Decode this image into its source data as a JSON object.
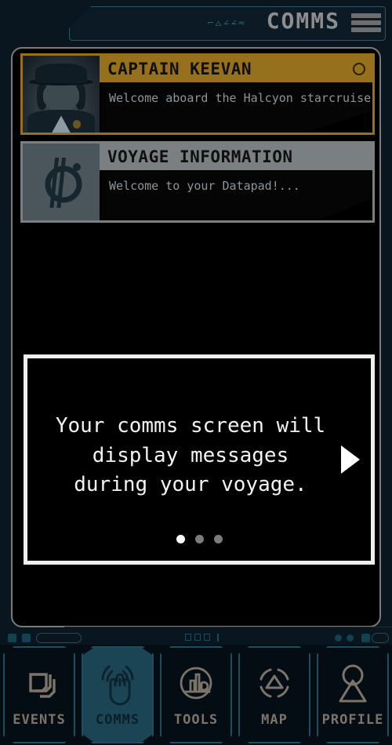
{
  "app": {
    "background_color": "#091620",
    "panel_color": "#000000"
  },
  "header": {
    "title": "COMMS",
    "aurebesh": "⌐△∠∠≈",
    "menu_icon": "hamburger-menu-icon",
    "accent_color": "#2b5560"
  },
  "messages": [
    {
      "sender": "CAPTAIN KEEVAN",
      "preview": "Welcome aboard the Halcyon starcruiser...",
      "unread": true,
      "accent_color": "#96701c",
      "avatar_icon": "captain-portrait"
    },
    {
      "sender": "VOYAGE INFORMATION",
      "preview": "Welcome to your Datapad!...",
      "unread": false,
      "accent_color": "#7a7f82",
      "avatar_icon": "halcyon-logo-icon"
    }
  ],
  "tooltip": {
    "text": "Your comms screen will display messages during your voyage.",
    "next_icon": "next-arrow-icon",
    "total_pages": 3,
    "current_page": 1
  },
  "bottom_nav": {
    "active": "COMMS",
    "items": [
      {
        "label": "EVENTS",
        "icon": "stacked-cards-icon",
        "active": false
      },
      {
        "label": "COMMS",
        "icon": "signal-hand-icon",
        "active": true
      },
      {
        "label": "TOOLS",
        "icon": "city-search-icon",
        "active": false
      },
      {
        "label": "MAP",
        "icon": "map-compass-icon",
        "active": false
      },
      {
        "label": "PROFILE",
        "icon": "person-icon",
        "active": false
      }
    ],
    "active_color": "#1b4454",
    "inactive_label_color": "#7c7468"
  }
}
